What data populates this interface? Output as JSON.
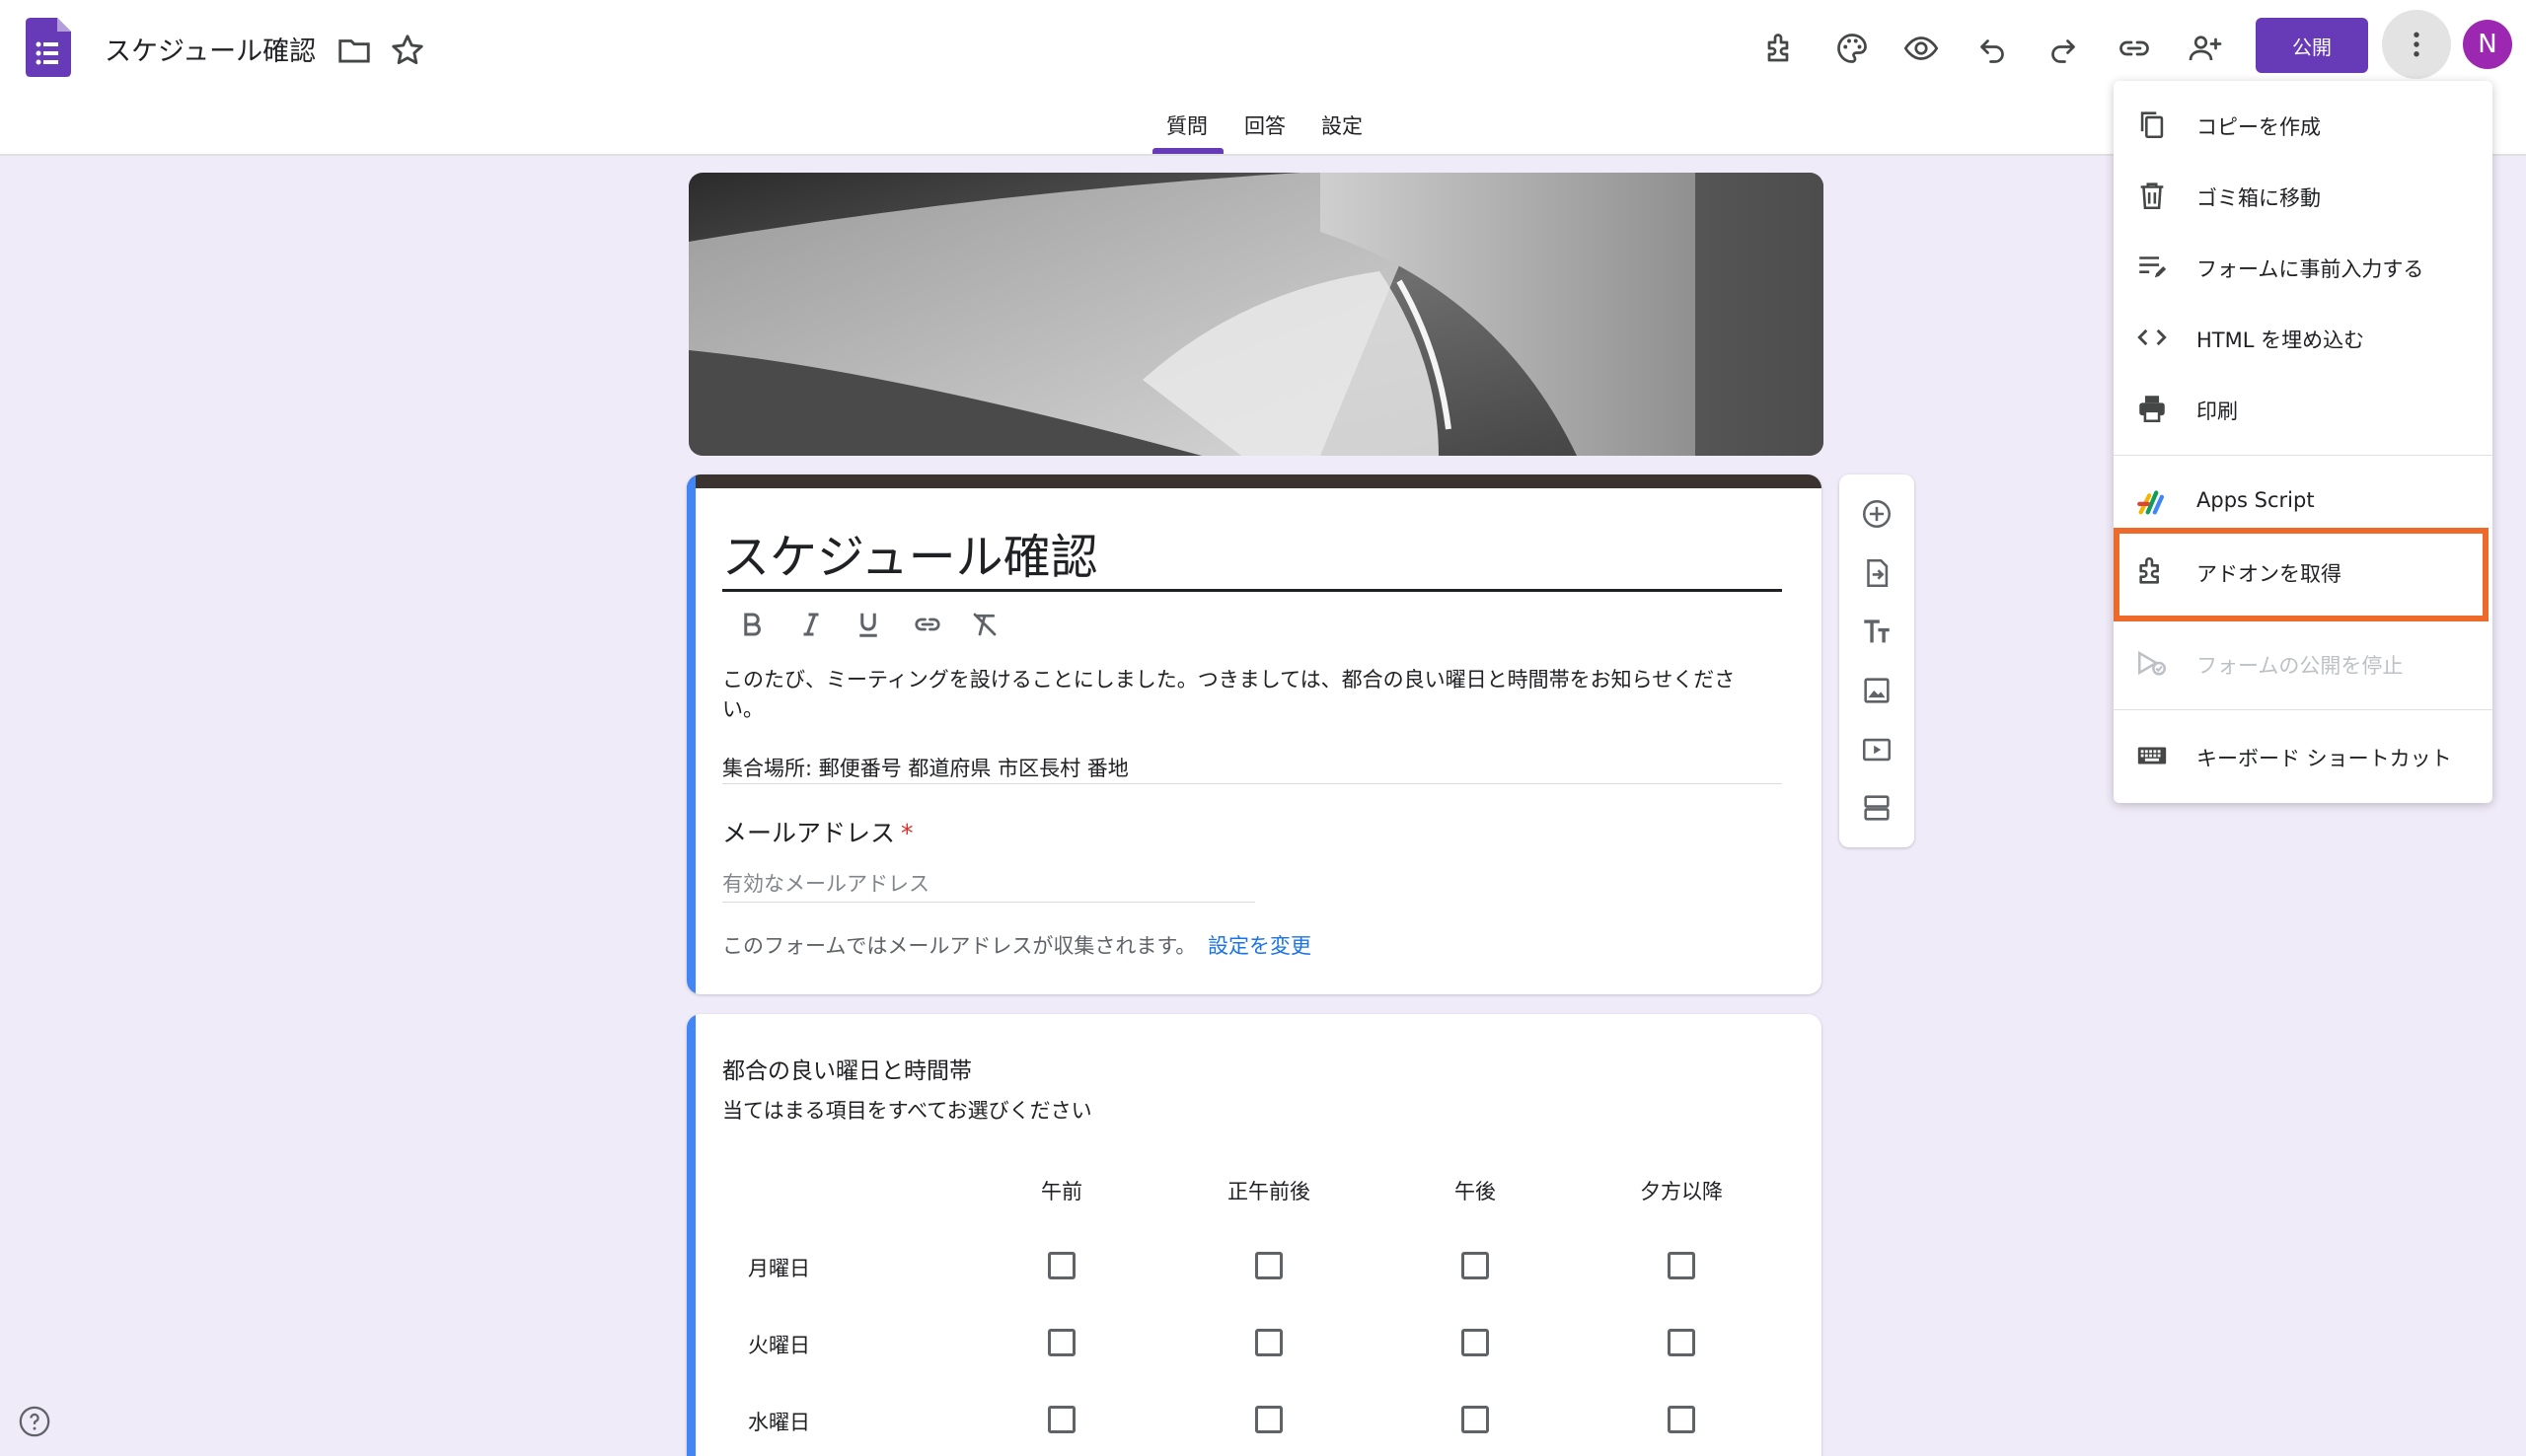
{
  "header": {
    "doc_title": "スケジュール確認",
    "publish_label": "公開",
    "avatar_initial": "N",
    "icons": [
      "folder-icon",
      "star-icon",
      "addon-icon",
      "palette-icon",
      "preview-icon",
      "undo-icon",
      "redo-icon",
      "link-icon",
      "add-collaborator-icon",
      "more-vert-icon"
    ]
  },
  "tabs": [
    {
      "label": "質問",
      "active": true
    },
    {
      "label": "回答",
      "active": false
    },
    {
      "label": "設定",
      "active": false
    }
  ],
  "form": {
    "title": "スケジュール確認",
    "description_lines": [
      "このたび、ミーティングを設けることにしました。つきましては、都合の良い曜日と時間帯をお知らせくださ",
      "い。"
    ],
    "location": "集合場所: 郵便番号 都道府県 市区長村 番地",
    "email_question": {
      "label": "メールアドレス",
      "required_mark": "*",
      "placeholder": "有効なメールアドレス"
    },
    "collect_note": "このフォームではメールアドレスが収集されます。",
    "settings_link": "設定を変更"
  },
  "grid_question": {
    "title": "都合の良い曜日と時間帯",
    "subtitle": "当てはまる項目をすべてお選びください",
    "columns": [
      "午前",
      "正午前後",
      "午後",
      "夕方以降"
    ],
    "rows": [
      "月曜日",
      "火曜日",
      "水曜日"
    ]
  },
  "side_toolbar": [
    "add-question-icon",
    "import-questions-icon",
    "add-title-icon",
    "add-image-icon",
    "add-video-icon",
    "add-section-icon"
  ],
  "menu": {
    "items": [
      {
        "label": "コピーを作成",
        "icon": "copy-icon",
        "disabled": false
      },
      {
        "label": "ゴミ箱に移動",
        "icon": "trash-icon",
        "disabled": false
      },
      {
        "label": "フォームに事前入力する",
        "icon": "prefill-icon",
        "disabled": false
      },
      {
        "label": "HTML を埋め込む",
        "icon": "code-icon",
        "disabled": false
      },
      {
        "label": "印刷",
        "icon": "print-icon",
        "disabled": false
      },
      {
        "label": "Apps Script",
        "icon": "apps-script-icon",
        "disabled": false
      },
      {
        "label": "アドオンを取得",
        "icon": "addon-icon",
        "disabled": false,
        "highlighted": true
      },
      {
        "label": "フォームの公開を停止",
        "icon": "unpublish-icon",
        "disabled": true
      },
      {
        "label": "キーボード ショートカット",
        "icon": "keyboard-icon",
        "disabled": false
      }
    ]
  },
  "colors": {
    "brand": "#673ab7",
    "accent_blue": "#4285f4",
    "highlight": "#ee6a2a",
    "background": "#f0ebf8"
  }
}
